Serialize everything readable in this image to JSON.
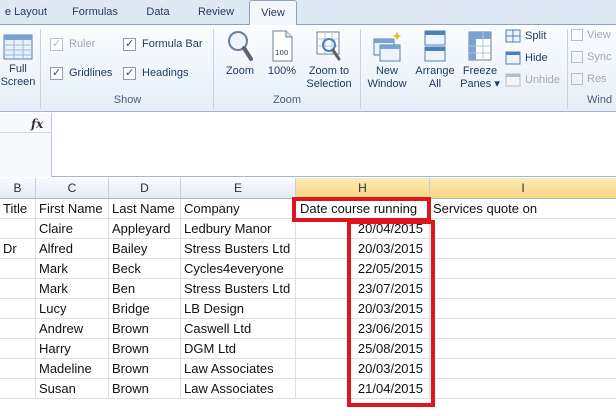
{
  "tabs": [
    {
      "label": "e Layout",
      "active": false
    },
    {
      "label": "Formulas",
      "active": false
    },
    {
      "label": "Data",
      "active": false
    },
    {
      "label": "Review",
      "active": false
    },
    {
      "label": "View",
      "active": true
    }
  ],
  "ribbon": {
    "full_screen_line1": "Full",
    "full_screen_line2": "Screen",
    "show": {
      "label": "Show",
      "ruler": "Ruler",
      "formula_bar": "Formula Bar",
      "gridlines": "Gridlines",
      "headings": "Headings"
    },
    "zoom": {
      "label": "Zoom",
      "zoom": "Zoom",
      "hundred": "100%",
      "zoom_to_selection_line1": "Zoom to",
      "zoom_to_selection_line2": "Selection"
    },
    "window": {
      "new_window_line1": "New",
      "new_window_line2": "Window",
      "arrange_all_line1": "Arrange",
      "arrange_all_line2": "All",
      "freeze_panes_line1": "Freeze",
      "freeze_panes_line2": "Panes ▾",
      "split": "Split",
      "hide": "Hide",
      "unhide": "Unhide",
      "view_side": "View",
      "sync": "Sync",
      "reset": "Res",
      "label": "Wind"
    }
  },
  "formula_bar": {
    "fx": "fx",
    "value": ""
  },
  "columns": [
    {
      "letter": "B",
      "selected": false
    },
    {
      "letter": "C",
      "selected": false
    },
    {
      "letter": "D",
      "selected": false
    },
    {
      "letter": "E",
      "selected": false
    },
    {
      "letter": "H",
      "selected": true
    },
    {
      "letter": "I",
      "selected": true
    }
  ],
  "rows": [
    [
      "Title",
      "First Name",
      "Last Name",
      "Company",
      "Date course running",
      "Services quote on"
    ],
    [
      "",
      "Claire",
      "Appleyard",
      "Ledbury Manor",
      "20/04/2015",
      ""
    ],
    [
      "Dr",
      "Alfred",
      "Bailey",
      "Stress Busters Ltd",
      "20/03/2015",
      ""
    ],
    [
      "",
      "Mark",
      "Beck",
      "Cycles4everyone",
      "22/05/2015",
      ""
    ],
    [
      "",
      "Mark",
      "Ben",
      "Stress Busters Ltd",
      "23/07/2015",
      ""
    ],
    [
      "",
      "Lucy",
      "Bridge",
      "LB Design",
      "20/03/2015",
      ""
    ],
    [
      "",
      "Andrew",
      "Brown",
      "Caswell Ltd",
      "23/06/2015",
      ""
    ],
    [
      "",
      "Harry",
      "Brown",
      "DGM Ltd",
      "25/08/2015",
      ""
    ],
    [
      "",
      "Madeline",
      "Brown",
      "Law Associates",
      "20/03/2015",
      ""
    ],
    [
      "",
      "Susan",
      "Brown",
      "Law Associates",
      "21/04/2015",
      ""
    ]
  ],
  "highlight_color": "#e0141e"
}
